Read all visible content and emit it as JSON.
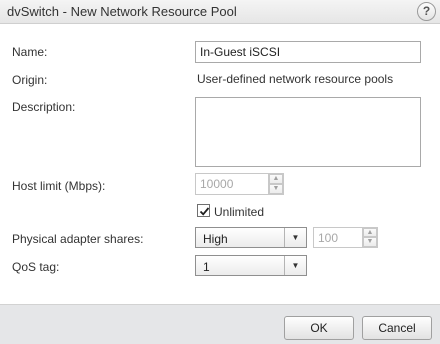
{
  "dialog": {
    "title": "dvSwitch - New Network Resource Pool",
    "help_glyph": "?"
  },
  "form": {
    "name_label": "Name:",
    "name_value": "In-Guest iSCSI",
    "origin_label": "Origin:",
    "origin_value": "User-defined network resource pools",
    "description_label": "Description:",
    "description_value": "",
    "host_limit_label": "Host limit (Mbps):",
    "host_limit_value": "10000",
    "unlimited_label": "Unlimited",
    "unlimited_checked": true,
    "shares_label": "Physical adapter shares:",
    "shares_selected": "High",
    "shares_value": "100",
    "qos_label": "QoS tag:",
    "qos_selected": "1"
  },
  "footer": {
    "ok_label": "OK",
    "cancel_label": "Cancel"
  }
}
